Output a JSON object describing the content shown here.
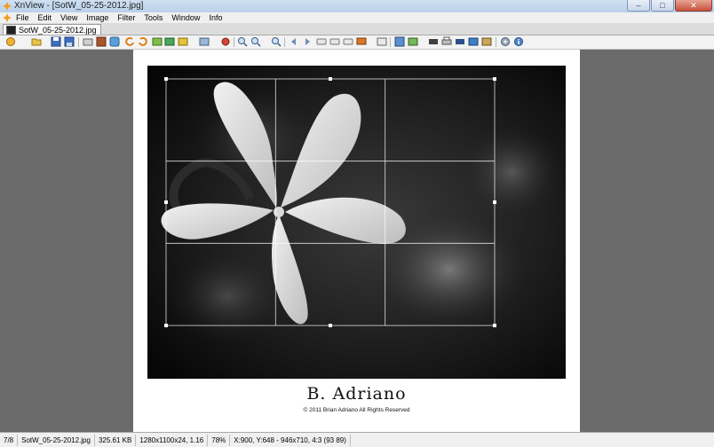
{
  "window": {
    "title": "XnView - [SotW_05-25-2012.jpg]"
  },
  "menu": {
    "items": [
      "File",
      "Edit",
      "View",
      "Image",
      "Filter",
      "Tools",
      "Window",
      "Info"
    ]
  },
  "tab": {
    "label": "SotW_05-25-2012.jpg"
  },
  "image": {
    "signature_name": "B. Adriano",
    "copyright": "© 2011 Brian Adriano All Rights Reserved"
  },
  "status": {
    "index": "7/8",
    "filename": "SotW_05-25-2012.jpg",
    "filesize": "325.61 KB",
    "dimensions": "1280x1100x24, 1.16",
    "zoom": "78%",
    "coords": "X:900, Y:648 - 946x710, 4:3 (93 89)"
  },
  "colors": {
    "titlebar": "#cfe0f2",
    "close_button": "#c7513d",
    "canvas_bg": "#6b6b6b"
  }
}
